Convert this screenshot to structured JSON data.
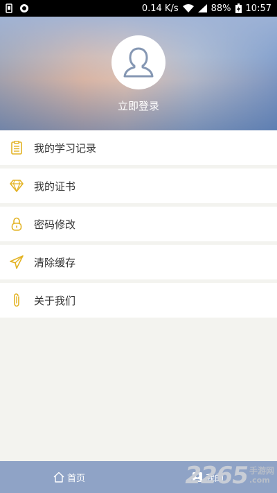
{
  "statusbar": {
    "speed": "0.14 K/s",
    "battery": "88%",
    "time": "10:57"
  },
  "header": {
    "login_label": "立即登录"
  },
  "menu": {
    "items": [
      {
        "label": "我的学习记录",
        "icon": "clipboard-icon"
      },
      {
        "label": "我的证书",
        "icon": "diamond-icon"
      },
      {
        "label": "密码修改",
        "icon": "lock-icon"
      },
      {
        "label": "清除缓存",
        "icon": "paper-plane-icon"
      },
      {
        "label": "关于我们",
        "icon": "paperclip-icon"
      }
    ]
  },
  "bottomnav": {
    "home_label": "首页",
    "mine_label": "我的"
  },
  "watermark": {
    "number": "2265",
    "cn": "手游网",
    "com": ".com"
  },
  "colors": {
    "accent": "#e3b325",
    "nav_bg": "#8fa3c6",
    "page_bg": "#f3f3ef"
  }
}
